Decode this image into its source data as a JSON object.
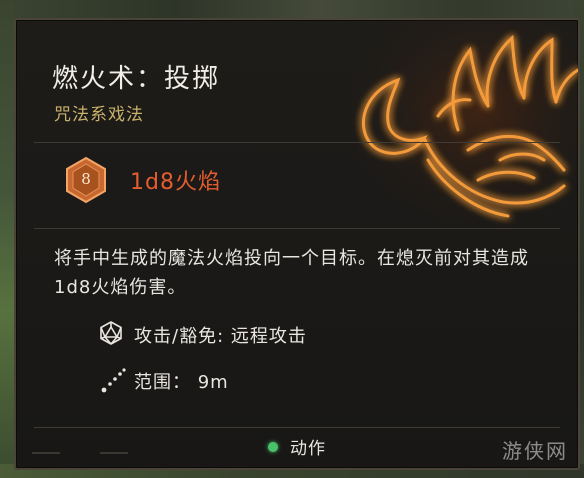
{
  "tooltip": {
    "title": "燃火术：投掷",
    "school": "咒法系戏法",
    "damage": {
      "die_value": "8",
      "text": "1d8火焰"
    },
    "description": "将手中生成的魔法火焰投向一个目标。在熄灭前对其造成1d8火焰伤害。",
    "stats": {
      "attack_save": "攻击/豁免: 远程攻击",
      "range": "范围： 9m"
    },
    "action_cost": "动作"
  },
  "watermark": "游侠网",
  "colors": {
    "title": "#f1eee8",
    "school": "#c9b26a",
    "damage": "#e35d2f",
    "die": "#c8682e",
    "action_dot": "#49c26a",
    "glow": "#f08a2a"
  },
  "icons": {
    "spell_art": "flaming-hand-icon",
    "damage_die": "d8-die-icon",
    "attack": "d20-icon",
    "range": "range-line-icon"
  }
}
